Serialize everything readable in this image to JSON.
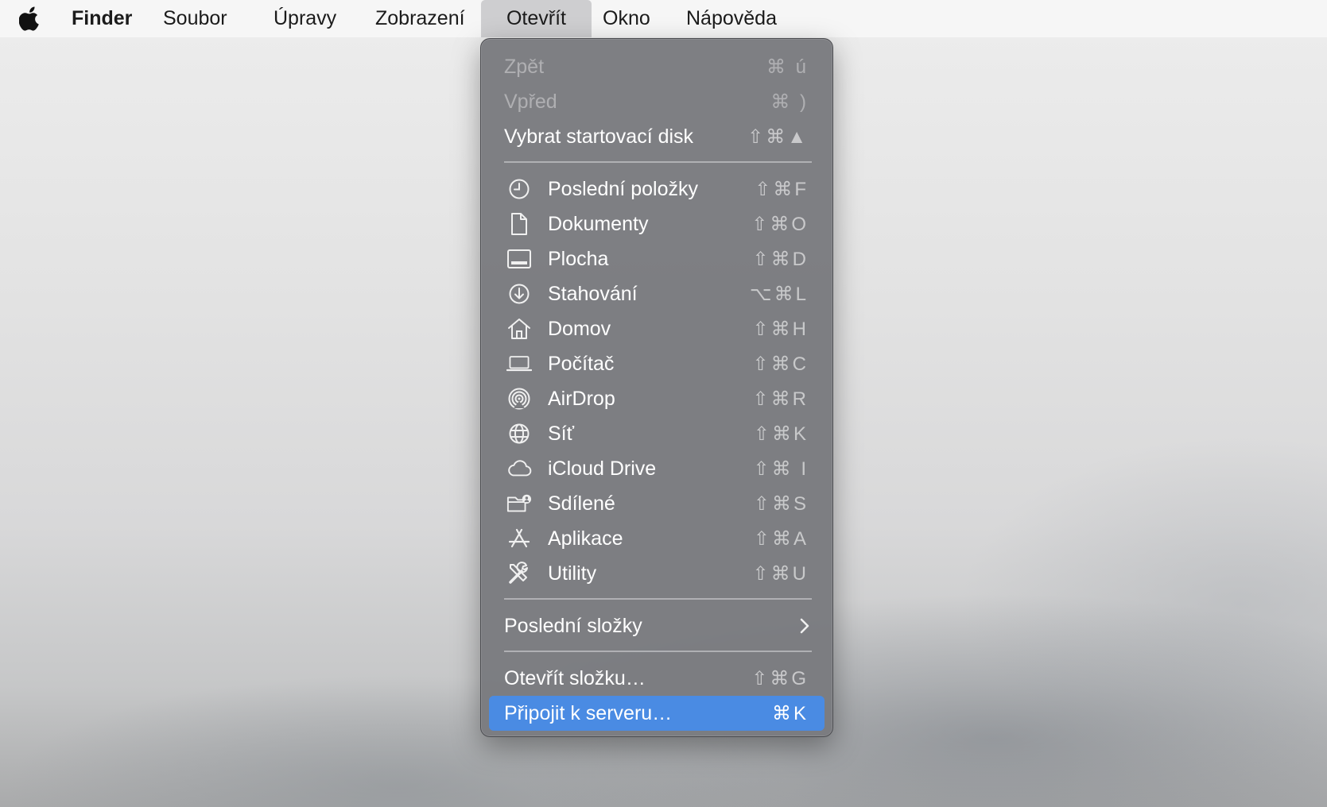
{
  "menubar": {
    "apple_icon": "apple-logo-icon",
    "app_name": "Finder",
    "items": [
      "Soubor",
      "Úpravy",
      "Zobrazení",
      "Otevřít",
      "Okno",
      "Nápověda"
    ],
    "active_item": "Otevřít"
  },
  "menu": {
    "back": {
      "label": "Zpět",
      "shortcut": "⌘ ú",
      "enabled": false
    },
    "forward": {
      "label": "Vpřed",
      "shortcut": "⌘ )",
      "enabled": false
    },
    "startup_disk": {
      "label": "Vybrat startovací disk",
      "shortcut": "⇧⌘▲"
    },
    "places": [
      {
        "label": "Poslední položky",
        "shortcut": "⇧⌘F",
        "icon": "clock-icon"
      },
      {
        "label": "Dokumenty",
        "shortcut": "⇧⌘O",
        "icon": "document-icon"
      },
      {
        "label": "Plocha",
        "shortcut": "⇧⌘D",
        "icon": "desktop-icon"
      },
      {
        "label": "Stahování",
        "shortcut": "⌥⌘L",
        "icon": "download-icon"
      },
      {
        "label": "Domov",
        "shortcut": "⇧⌘H",
        "icon": "home-icon"
      },
      {
        "label": "Počítač",
        "shortcut": "⇧⌘C",
        "icon": "laptop-icon"
      },
      {
        "label": "AirDrop",
        "shortcut": "⇧⌘R",
        "icon": "airdrop-icon"
      },
      {
        "label": "Síť",
        "shortcut": "⇧⌘K",
        "icon": "globe-icon"
      },
      {
        "label": "iCloud Drive",
        "shortcut": "⇧⌘ I",
        "icon": "cloud-icon"
      },
      {
        "label": "Sdílené",
        "shortcut": "⇧⌘S",
        "icon": "shared-folder-icon"
      },
      {
        "label": "Aplikace",
        "shortcut": "⇧⌘A",
        "icon": "applications-icon"
      },
      {
        "label": "Utility",
        "shortcut": "⇧⌘U",
        "icon": "utilities-icon"
      }
    ],
    "recent_folders": {
      "label": "Poslední složky",
      "icon": "chevron-right-icon"
    },
    "go_to_folder": {
      "label": "Otevřít složku…",
      "shortcut": "⇧⌘G"
    },
    "connect_server": {
      "label": "Připojit k serveru…",
      "shortcut": "⌘K",
      "highlighted": true
    }
  },
  "colors": {
    "menu_bg": "#7a7b7f",
    "highlight": "#4a8be3",
    "menubar_bg": "#f6f6f6"
  }
}
